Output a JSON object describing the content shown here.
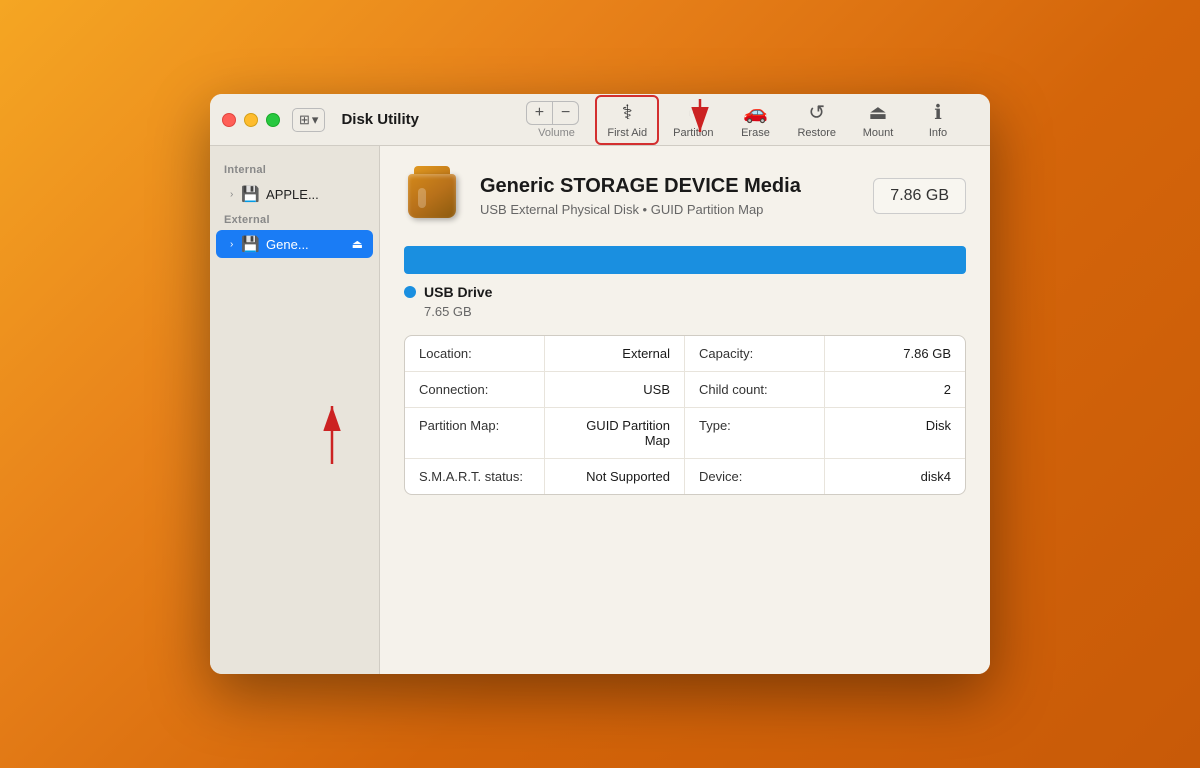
{
  "window": {
    "title": "Disk Utility"
  },
  "titlebar": {
    "view_label": "View",
    "view_icon": "⊞"
  },
  "toolbar": {
    "volume_add": "+",
    "volume_remove": "−",
    "volume_label": "Volume",
    "first_aid_label": "First Aid",
    "partition_label": "Partition",
    "erase_label": "Erase",
    "restore_label": "Restore",
    "mount_label": "Mount",
    "info_label": "Info"
  },
  "sidebar": {
    "internal_label": "Internal",
    "internal_item": "APPLE...",
    "external_label": "External",
    "external_item": "Gene..."
  },
  "device": {
    "name": "Generic STORAGE DEVICE Media",
    "subtitle": "USB External Physical Disk • GUID Partition Map",
    "size": "7.86 GB"
  },
  "partition": {
    "bar_color": "#1a8fe0",
    "label": "USB Drive",
    "size": "7.65 GB"
  },
  "info_table": {
    "rows": [
      {
        "left_label": "Location:",
        "left_value": "External",
        "right_label": "Capacity:",
        "right_value": "7.86 GB"
      },
      {
        "left_label": "Connection:",
        "left_value": "USB",
        "right_label": "Child count:",
        "right_value": "2"
      },
      {
        "left_label": "Partition Map:",
        "left_value": "GUID Partition Map",
        "right_label": "Type:",
        "right_value": "Disk"
      },
      {
        "left_label": "S.M.A.R.T. status:",
        "left_value": "Not Supported",
        "right_label": "Device:",
        "right_value": "disk4"
      }
    ]
  },
  "annotations": {
    "arrow1_label": "First Aid highlighted",
    "arrow2_label": "External drive selected"
  }
}
